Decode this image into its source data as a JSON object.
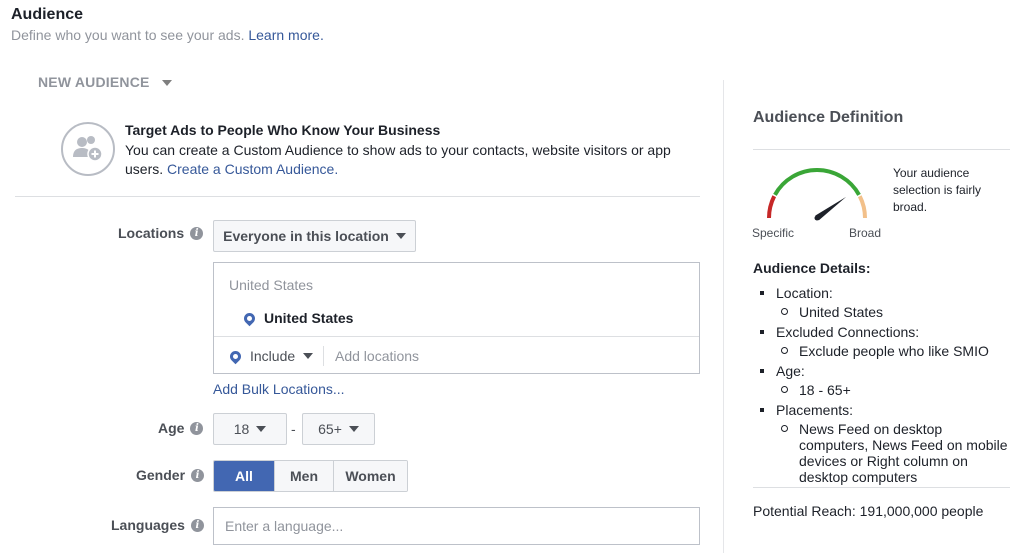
{
  "header": {
    "title": "Audience",
    "subtitle": "Define who you want to see your ads.",
    "learn_more": "Learn more."
  },
  "new_audience_label": "NEW AUDIENCE",
  "custom_audience": {
    "icon": "add-people-icon",
    "title": "Target Ads to People Who Know Your Business",
    "text": "You can create a Custom Audience to show ads to your contacts, website visitors or app users.",
    "link": "Create a Custom Audience."
  },
  "locations": {
    "label": "Locations",
    "mode": "Everyone in this location",
    "hint": "United States",
    "selected": "United States",
    "include_label": "Include",
    "add_placeholder": "Add locations",
    "bulk_link": "Add Bulk Locations..."
  },
  "age": {
    "label": "Age",
    "min": "18",
    "separator": "-",
    "max": "65+"
  },
  "gender": {
    "label": "Gender",
    "options": [
      "All",
      "Men",
      "Women"
    ],
    "selected": "All"
  },
  "languages": {
    "label": "Languages",
    "placeholder": "Enter a language..."
  },
  "definition": {
    "title": "Audience Definition",
    "gauge_level": 0.8,
    "specific_label": "Specific",
    "broad_label": "Broad",
    "description": "Your audience selection is fairly broad.",
    "colors": {
      "specific": "#c62828",
      "middle": "#3aa637",
      "broad": "#f2c08a"
    }
  },
  "details": {
    "title": "Audience Details:",
    "items": [
      {
        "label": "Location:",
        "sub": "United States"
      },
      {
        "label": "Excluded Connections:",
        "sub": "Exclude people who like SMIO"
      },
      {
        "label": "Age:",
        "sub": "18 - 65+"
      },
      {
        "label": "Placements:",
        "sub": "News Feed on desktop computers, News Feed on mobile devices or Right column on desktop computers"
      }
    ]
  },
  "potential_reach": "Potential Reach: 191,000,000 people"
}
